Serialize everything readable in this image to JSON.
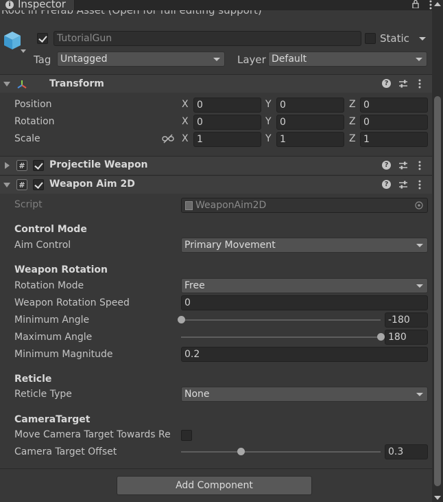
{
  "window": {
    "tab_title": "Inspector",
    "info_glyph": "i"
  },
  "prefab_notice": "Root in Prefab Asset (Open for full editing support)",
  "gameobject": {
    "active": true,
    "name": "TutorialGun",
    "static_label": "Static",
    "static_checked": false,
    "tag_label": "Tag",
    "tag_value": "Untagged",
    "layer_label": "Layer",
    "layer_value": "Default"
  },
  "transform": {
    "title": "Transform",
    "rows": [
      {
        "label": "Position",
        "x": "0",
        "y": "0",
        "z": "0"
      },
      {
        "label": "Rotation",
        "x": "0",
        "y": "0",
        "z": "0"
      },
      {
        "label": "Scale",
        "x": "1",
        "y": "1",
        "z": "1"
      }
    ],
    "axis_labels": [
      "X",
      "Y",
      "Z"
    ]
  },
  "components": [
    {
      "title": "Projectile Weapon",
      "enabled": true,
      "expanded": false
    },
    {
      "title": "Weapon Aim 2D",
      "enabled": true,
      "expanded": true
    }
  ],
  "weapon_aim": {
    "script_label": "Script",
    "script_value": "WeaponAim2D",
    "control_mode_header": "Control Mode",
    "aim_control_label": "Aim Control",
    "aim_control_value": "Primary Movement",
    "weapon_rotation_header": "Weapon Rotation",
    "rotation_mode_label": "Rotation Mode",
    "rotation_mode_value": "Free",
    "rotation_speed_label": "Weapon Rotation Speed",
    "rotation_speed_value": "0",
    "min_angle_label": "Minimum Angle",
    "min_angle_value": "-180",
    "min_angle_fraction": 0.0,
    "max_angle_label": "Maximum Angle",
    "max_angle_value": "180",
    "max_angle_fraction": 1.0,
    "min_magnitude_label": "Minimum Magnitude",
    "min_magnitude_value": "0.2",
    "reticle_header": "Reticle",
    "reticle_type_label": "Reticle Type",
    "reticle_type_value": "None",
    "camera_target_header": "CameraTarget",
    "move_camera_label": "Move Camera Target Towards Re",
    "move_camera_checked": false,
    "camera_offset_label": "Camera Target Offset",
    "camera_offset_value": "0.3",
    "camera_offset_fraction": 0.3
  },
  "add_component_label": "Add Component",
  "colors": {
    "panel_bg": "#383838",
    "header_bg": "#3e3e3e",
    "field_bg": "#2a2a2a",
    "dropdown_bg": "#515151"
  }
}
